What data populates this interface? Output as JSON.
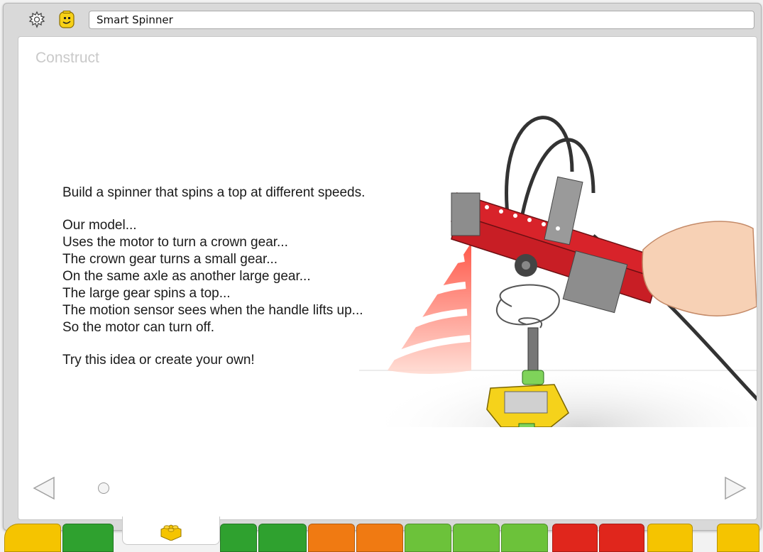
{
  "window": {
    "title_value": "Smart Spinner"
  },
  "icons": {
    "settings": "gear-icon",
    "character": "minifig-face-icon",
    "prev": "triangle-left-icon",
    "next": "triangle-right-icon",
    "palette_tab": "lego-brick-icon"
  },
  "page": {
    "section_label": "Construct",
    "lines": [
      "Build a spinner that spins a top at different speeds.",
      "",
      "Our model...",
      "Uses the motor to turn a crown gear...",
      "The crown gear turns a small gear...",
      "On the same axle as another large gear...",
      "The large gear spins a top...",
      "The motion sensor sees when the handle lifts up...",
      "So the motor can turn off.",
      "",
      "Try this idea or create your own!"
    ]
  },
  "pager": {
    "current_page": 1,
    "total_pages": 1
  },
  "colors": {
    "palette_yellow": "#f5c400",
    "palette_green": "#2fa12f",
    "palette_orange": "#f07a12",
    "palette_lime": "#6cc23a",
    "palette_red": "#e0261c",
    "brick_red": "#d8232a",
    "sensor_red": "#ff5a3c"
  }
}
